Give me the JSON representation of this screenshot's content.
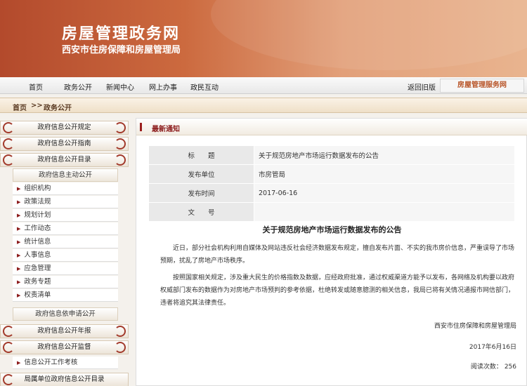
{
  "banner": {
    "title": "房屋管理政务网",
    "subtitle": "西安市住房保障和房屋管理局"
  },
  "nav": {
    "items": [
      "首页",
      "政务公开",
      "新闻中心",
      "网上办事",
      "政民互动"
    ],
    "back": "返回旧版",
    "service": "房屋管理服务网"
  },
  "breadcrumb": {
    "home": "首页",
    "sep": ">>",
    "current": "政务公开"
  },
  "sidebar": {
    "heads": [
      "政府信息公开规定",
      "政府信息公开指南",
      "政府信息公开目录"
    ],
    "active_sub": "政府信息主动公开",
    "items": [
      "组织机构",
      "政策法规",
      "规划计划",
      "工作动态",
      "统计信息",
      "人事信息",
      "应急管理",
      "政务专题",
      "权责清单"
    ],
    "apply": "政府信息依申请公开",
    "heads2": [
      "政府信息公开年报",
      "政府信息公开监督"
    ],
    "review": "信息公开工作考核",
    "bottom": "局属单位政府信息公开目录"
  },
  "main": {
    "section_title": "最新通知",
    "meta": [
      {
        "k": "标　　题",
        "v": "关于规范房地产市场运行数据发布的公告"
      },
      {
        "k": "发布单位",
        "v": "市房管局"
      },
      {
        "k": "发布时间",
        "v": "2017-06-16"
      },
      {
        "k": "文　　号",
        "v": ""
      }
    ],
    "doc_title": "关于规范房地产市场运行数据发布的公告",
    "p1": "近日，部分社会机构利用自媒体及网站违反社会经济数据发布规定，擅自发布片面、不实的我市房价信息，严重误导了市场预期，扰乱了房地产市场秩序。",
    "p2": "按照国家相关规定，涉及重大民生的价格指数及数据，应经政府批准，通过权威渠道方能予以发布，各网络及机构要以政府权威部门发布的数据作为对房地产市场预判的参考依据，杜绝转发或随意臆测的相关信息，我局已将有关情况通报市网信部门，违者将追究其法律责任。",
    "sig_org": "西安市住房保障和房屋管理局",
    "sig_date": "2017年6月16日",
    "read_label": "阅读次数：",
    "read_count": "256"
  },
  "colors": {
    "accent": "#8b1a1a",
    "banner": "#c45e37"
  }
}
